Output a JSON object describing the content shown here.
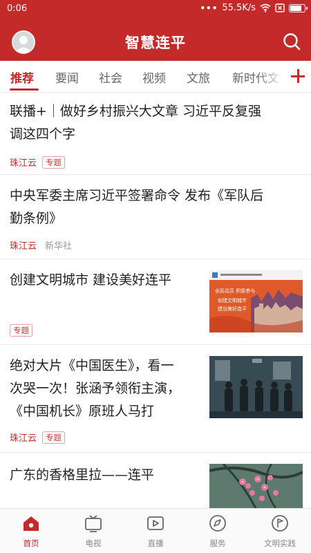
{
  "status_bar": {
    "time": "0:06",
    "dots": "•••",
    "network_speed": "55.5K/s",
    "battery_level": 0.85
  },
  "header": {
    "title": "智慧连平"
  },
  "tabs": [
    {
      "label": "推荐",
      "active": true
    },
    {
      "label": "要闻"
    },
    {
      "label": "社会"
    },
    {
      "label": "视频"
    },
    {
      "label": "文旅"
    },
    {
      "label": "新时代文"
    }
  ],
  "articles": [
    {
      "title_line1": "联播+｜做好乡村振兴大文章 习近平反复强",
      "title_line2": "调这四个字",
      "source": "珠江云",
      "badge": "专题"
    },
    {
      "title_line1": "中央军委主席习近平签署命令 发布《军队后",
      "title_line2": "勤条例》",
      "source": "珠江云",
      "publisher": "新华社"
    },
    {
      "title_line1": "创建文明城市 建设美好连平",
      "badge": "专题",
      "thumb_text": [
        "全民动员 积极参与",
        "创建文明城市",
        "建设美好连平"
      ]
    },
    {
      "title_line1": "绝对大片《中国医生》，看一",
      "title_line2": "次哭一次！张涵予领衔主演，",
      "title_line3": "《中国机长》原班人马打",
      "source": "珠江云",
      "badge": "专题"
    },
    {
      "title_line1": "广东的香格里拉——连平"
    }
  ],
  "tabbar": [
    {
      "label": "首页",
      "icon": "home-icon",
      "active": true
    },
    {
      "label": "电视",
      "icon": "tv-icon"
    },
    {
      "label": "直播",
      "icon": "live-icon"
    },
    {
      "label": "服务",
      "icon": "compass-icon"
    },
    {
      "label": "文明实践",
      "icon": "flag-icon"
    }
  ],
  "colors": {
    "brand": "#c42a2a",
    "header_bg": "#c42a2a",
    "tab_inactive": "#666666"
  }
}
